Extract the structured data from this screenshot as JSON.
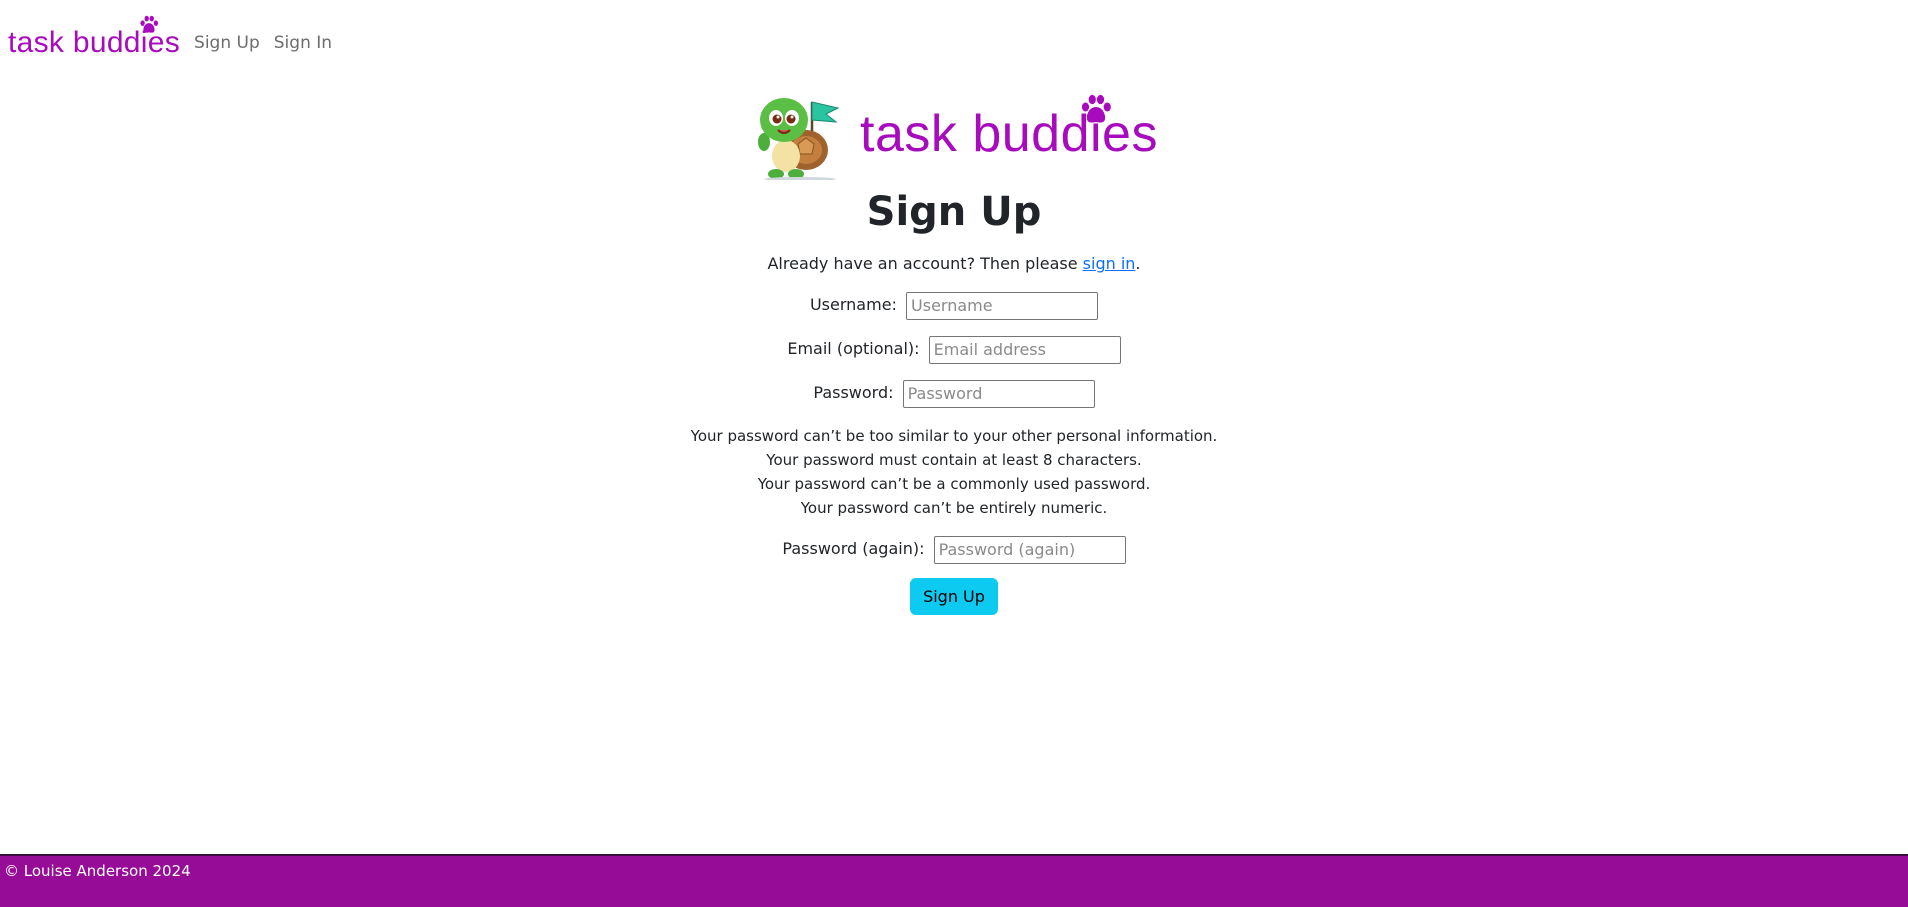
{
  "nav": {
    "brand": "task buddies",
    "links": [
      "Sign Up",
      "Sign In"
    ]
  },
  "hero": {
    "brand": "task buddies"
  },
  "form": {
    "title": "Sign Up",
    "intro_text": "Already have an account? Then please ",
    "intro_link": "sign in",
    "intro_end": ".",
    "fields": [
      {
        "label": "Username:",
        "placeholder": "Username",
        "value": ""
      },
      {
        "label": "Email (optional):",
        "placeholder": "Email address",
        "value": ""
      },
      {
        "label": "Password:",
        "placeholder": "Password",
        "value": ""
      },
      {
        "label": "Password (again):",
        "placeholder": "Password (again)",
        "value": ""
      }
    ],
    "help_text": [
      "Your password can’t be too similar to your other personal information.",
      "Your password must contain at least 8 characters.",
      "Your password can’t be a commonly used password.",
      "Your password can’t be entirely numeric."
    ],
    "submit_label": "Sign Up"
  },
  "footer": {
    "text": "© Louise Anderson 2024"
  },
  "colors": {
    "brand": "#a80bbd",
    "footer_bg": "#970c97",
    "button_bg": "#0dcaf0",
    "link": "#0d6efd"
  },
  "icons": [
    "paw-icon",
    "turtle-mascot"
  ]
}
